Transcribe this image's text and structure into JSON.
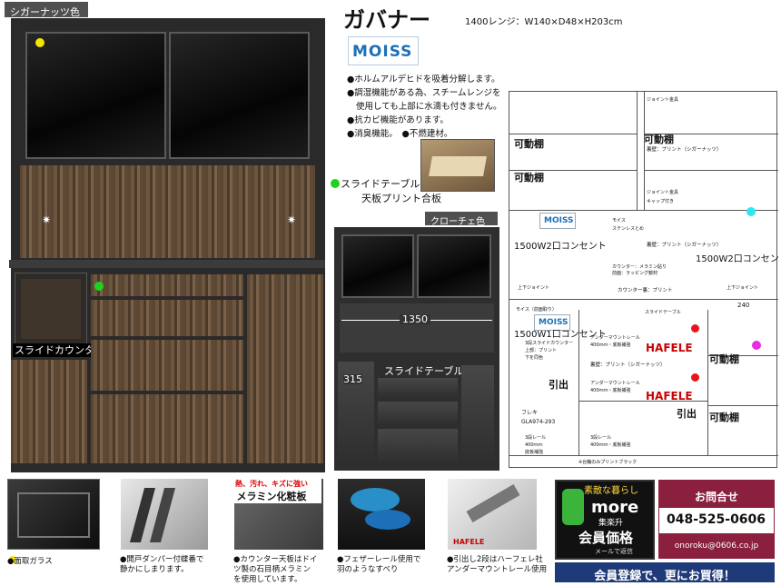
{
  "product": {
    "title": "ガバナー",
    "spec": "1400レンジ：W140×D48×H203cm",
    "color_main": "シガーナッツ色",
    "color_alt": "クローチェ色",
    "moiss_logo": "MOISS"
  },
  "features": [
    "●ホルムアルデヒドを吸着分解します。",
    "●調湿機能がある為、スチームレンジを",
    "使用しても上部に水滴も付きません。",
    "●抗カビ機能があります。",
    "●消臭機能。　●不燃建材。"
  ],
  "labels": {
    "slide_table": "スライドテーブル",
    "tenban": "天板プリント合板",
    "slide_counter": "スライドカウンター",
    "dim_1350": "1350",
    "dim_315": "315",
    "slide_table2": "スライドテーブル"
  },
  "diagram": {
    "kadoudana": [
      "可動棚",
      "可動棚",
      "可動棚",
      "可動棚",
      "可動棚"
    ],
    "concent_left": "1500W2口コンセント",
    "concent_right": "1500W2口コンセント",
    "concent_lower": "1500W1口コンセント",
    "hikidashi": [
      "引出",
      "引出"
    ],
    "hafele": [
      "HAFELE",
      "HAFELE"
    ],
    "small": [
      "ジョイント金具",
      "裏壁：プリント（シガーナッツ）",
      "ジョイント金具",
      "キャップ付き",
      "モイス",
      "ステンレスとめ",
      "裏壁：プリント（シガーナッツ）",
      "カウンター：メラミン貼り",
      "前面：ラッピング鏡材",
      "上下ジョイント",
      "カウンター裏：プリント",
      "上下ジョイント",
      "モイス（前面取り）",
      "スライドテーブル",
      "3段スライドカウンター",
      "アンダーマウントレール",
      "400ｍｍ・底板補強",
      "裏壁：プリント（シガーナッツ）",
      "アンダーマウントレール",
      "400ｍｍ・底板補強",
      "フレキ",
      "GLA974-293",
      "3段レール",
      "400ｍｍ",
      "底板補強",
      "3段レール",
      "400ｍｍ・底板補強",
      "※台輪のみプリントブラック",
      "上部：プリント",
      "下を同色"
    ],
    "dims": [
      "240",
      "240"
    ]
  },
  "bottom_captions": [
    "●面取ガラス",
    "●開戸ダンパー付蝶番で\n静かにしまります。",
    "●カウンター天板はドイ\nツ製の石目柄メラミン\nを使用しています。",
    "●フェザーレール使用で\n羽のようなすべり",
    "●引出し2段はハーフェレ社\nアンダーマウントレール使用"
  ],
  "melamine_tag": {
    "line1": "熱、汚れ、キズに強い",
    "line2": "メラミン化粧板"
  },
  "shop": {
    "banner_top": "素敵な暮らし",
    "logo": "more",
    "logo_sub": "集楽升",
    "member_price": "会員価格",
    "member_sub": "メールで返信"
  },
  "contact": {
    "title": "お問合せ",
    "phone": "048-525-0606",
    "email": "onoroku@0606.co.jp"
  },
  "register_banner": "会員登録で、更にお買得！",
  "colors": {
    "yellow": "#f3e600",
    "green": "#1fd21f",
    "cyan": "#2ee6ef",
    "magenta": "#e62ee0",
    "red": "#e8141a",
    "maroon": "#8a1f3e",
    "navy": "#1f3a78"
  }
}
